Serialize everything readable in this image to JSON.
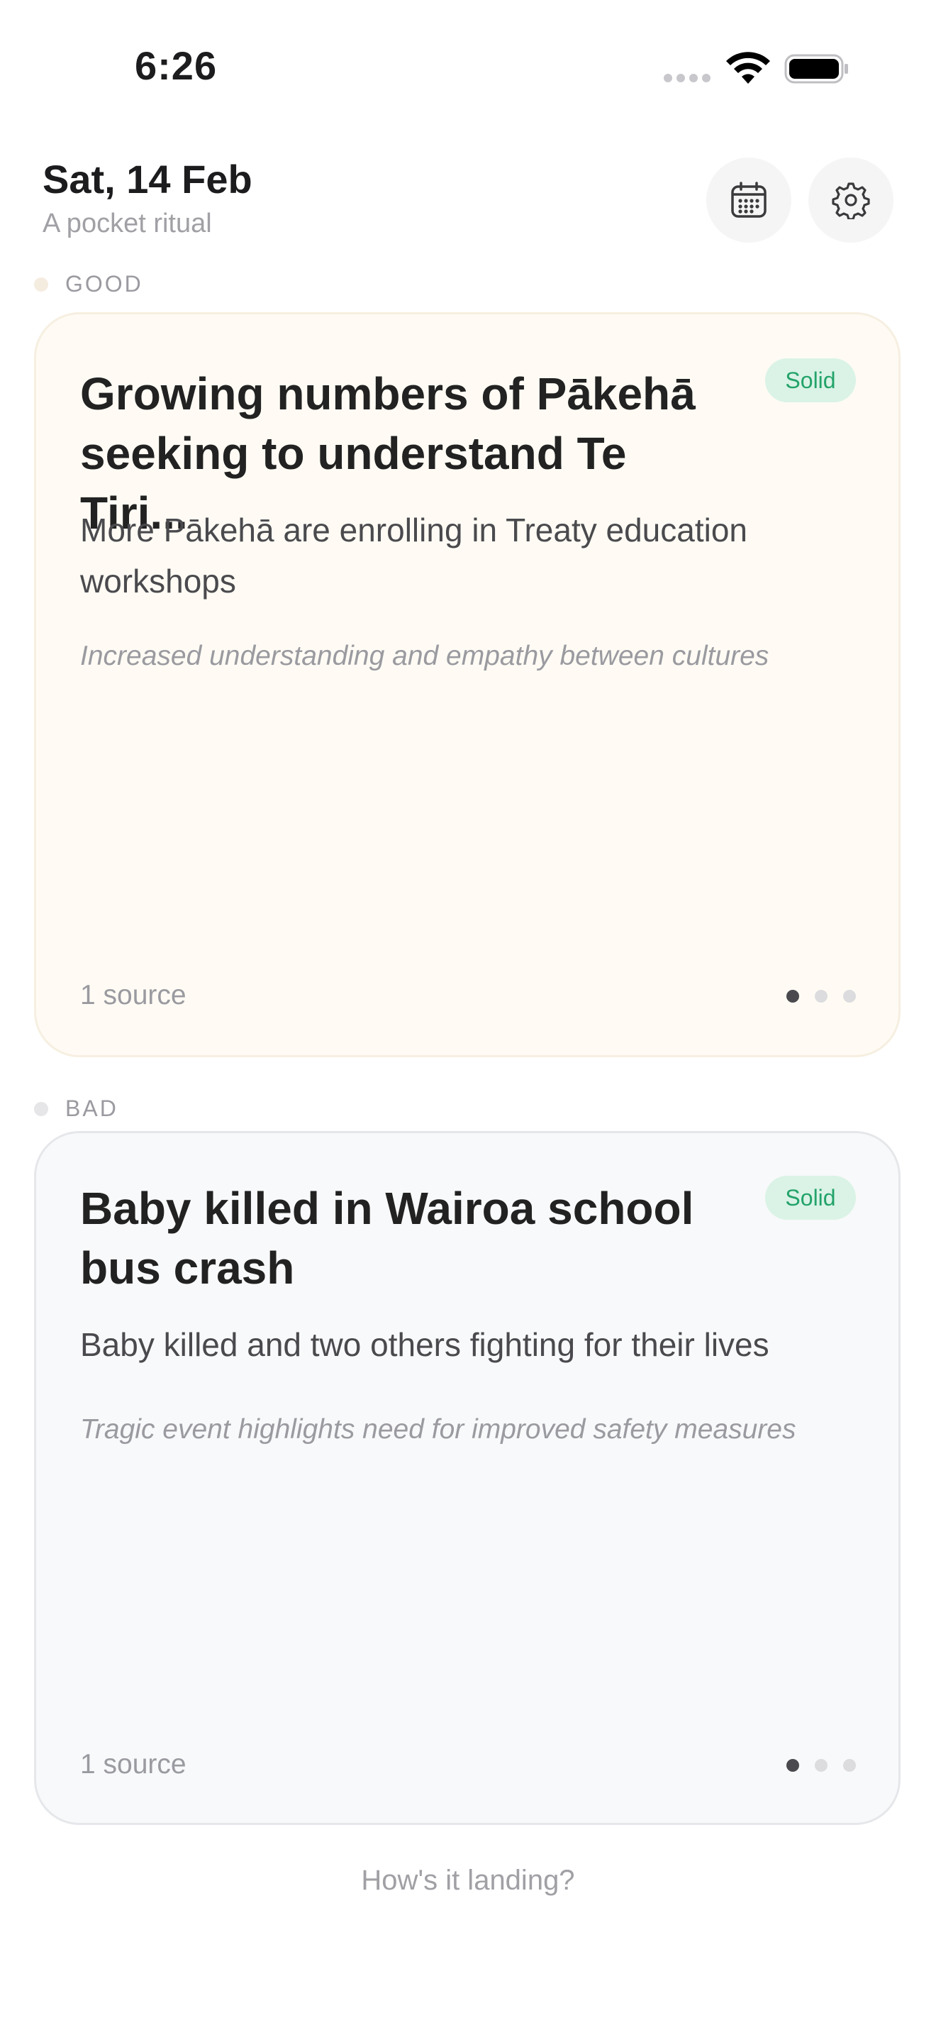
{
  "status_bar": {
    "time": "6:26"
  },
  "header": {
    "date": "Sat, 14 Feb",
    "subtitle": "A pocket ritual",
    "icons": {
      "calendar": "calendar-icon",
      "settings": "gear-icon"
    }
  },
  "sections": [
    {
      "label": "GOOD",
      "dot_color": "#f5ece0",
      "card": {
        "title": "Growing numbers of Pākehā seeking to understand Te Tiri...",
        "badge": "Solid",
        "summary": "More Pākehā are enrolling in Treaty education workshops",
        "note": "Increased understanding and empathy between cultures",
        "sources": "1 source",
        "pager": {
          "pages": 3,
          "current": 1
        }
      }
    },
    {
      "label": "BAD",
      "dot_color": "#e6e6e8",
      "card": {
        "title": "Baby killed in Wairoa school bus crash",
        "badge": "Solid",
        "summary": "Baby killed and two others fighting for their lives",
        "note": "Tragic event highlights need for improved safety measures",
        "sources": "1 source",
        "pager": {
          "pages": 3,
          "current": 1
        }
      }
    }
  ],
  "footer": {
    "prompt": "How's it landing?"
  },
  "colors": {
    "accent_green": "#23a36a",
    "badge_bg": "#daf3e6",
    "good_card_bg": "#fffbf4",
    "bad_card_bg": "#f8f9fa"
  }
}
